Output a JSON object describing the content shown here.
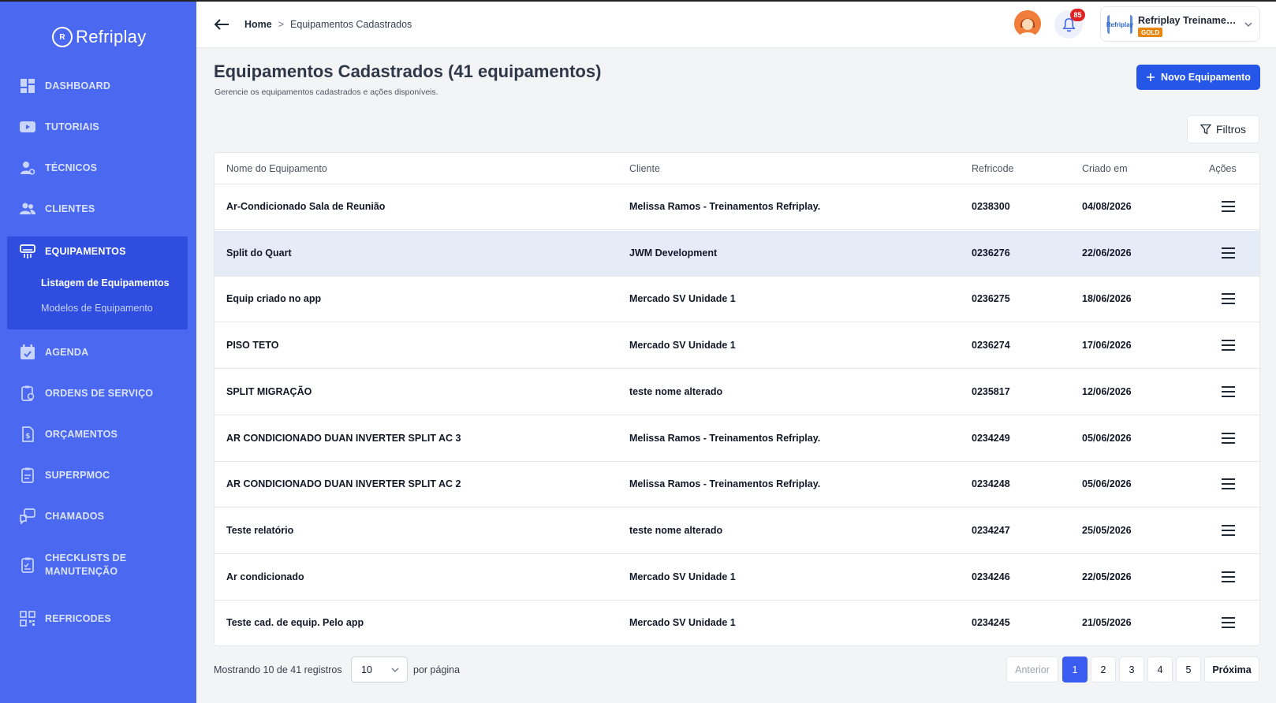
{
  "app": {
    "logo_text": "Refriplay",
    "logo_mark": "R"
  },
  "sidebar": {
    "items": [
      {
        "label": "DASHBOARD"
      },
      {
        "label": "TUTORIAIS"
      },
      {
        "label": "TÉCNICOS"
      },
      {
        "label": "CLIENTES"
      },
      {
        "label": "EQUIPAMENTOS",
        "active": true
      },
      {
        "label": "AGENDA"
      },
      {
        "label": "ORDENS DE SERVIÇO"
      },
      {
        "label": "ORÇAMENTOS"
      },
      {
        "label": "SUPERPMOC"
      },
      {
        "label": "CHAMADOS"
      },
      {
        "label": "CHECKLISTS DE",
        "label2": "MANUTENÇÃO"
      },
      {
        "label": "REFRICODES"
      }
    ],
    "sub_items": [
      {
        "label": "Listagem de Equipamentos",
        "current": true
      },
      {
        "label": "Modelos de Equipamento"
      }
    ]
  },
  "header": {
    "breadcrumb": {
      "home": "Home",
      "separator": ">",
      "current": "Equipamentos Cadastrados"
    },
    "notifications_count": "85",
    "account": {
      "name": "Refriplay Treinament...",
      "badge": "GOLD",
      "logo_text": "Refriplay"
    }
  },
  "page": {
    "title": "Equipamentos Cadastrados (41 equipamentos)",
    "subtitle": "Gerencie os equipamentos cadastrados e ações disponíveis.",
    "new_button": "Novo Equipamento",
    "filter_button": "Filtros"
  },
  "table": {
    "columns": [
      "Nome do Equipamento",
      "Cliente",
      "Refricode",
      "Criado em",
      "Ações"
    ],
    "rows": [
      {
        "name": "Ar-Condicionado Sala de Reunião",
        "client": "Melissa Ramos - Treinamentos Refriplay.",
        "code": "0238300",
        "date": "04/08/2026"
      },
      {
        "name": "Split do Quart",
        "client": "JWM Development",
        "code": "0236276",
        "date": "22/06/2026"
      },
      {
        "name": "Equip criado no app",
        "client": "Mercado SV Unidade 1",
        "code": "0236275",
        "date": "18/06/2026"
      },
      {
        "name": "PISO TETO",
        "client": "Mercado SV Unidade 1",
        "code": "0236274",
        "date": "17/06/2026"
      },
      {
        "name": "SPLIT MIGRAÇÃO",
        "client": "teste nome alterado",
        "code": "0235817",
        "date": "12/06/2026"
      },
      {
        "name": "AR CONDICIONADO DUAN INVERTER SPLIT AC 3",
        "client": "Melissa Ramos - Treinamentos Refriplay.",
        "code": "0234249",
        "date": "05/06/2026"
      },
      {
        "name": "AR CONDICIONADO DUAN INVERTER SPLIT AC 2",
        "client": "Melissa Ramos - Treinamentos Refriplay.",
        "code": "0234248",
        "date": "05/06/2026"
      },
      {
        "name": "Teste relatório",
        "client": "teste nome alterado",
        "code": "0234247",
        "date": "25/05/2026"
      },
      {
        "name": "Ar condicionado",
        "client": "Mercado SV Unidade 1",
        "code": "0234246",
        "date": "22/05/2026"
      },
      {
        "name": "Teste cad. de equip. Pelo app",
        "client": "Mercado SV Unidade 1",
        "code": "0234245",
        "date": "21/05/2026"
      }
    ]
  },
  "pagination": {
    "showing": "Mostrando 10 de 41 registros",
    "per_page_value": "10",
    "per_page_label": "por página",
    "prev": "Anterior",
    "pages": [
      "1",
      "2",
      "3",
      "4",
      "5"
    ],
    "next": "Próxima"
  },
  "colors": {
    "sidebar": "#4a68f0",
    "sidebar_active": "#2f4ee0",
    "primary": "#2556e8",
    "row_highlight": "#e6ebf8",
    "badge_red": "#e02424",
    "gold": "#e8870b"
  }
}
